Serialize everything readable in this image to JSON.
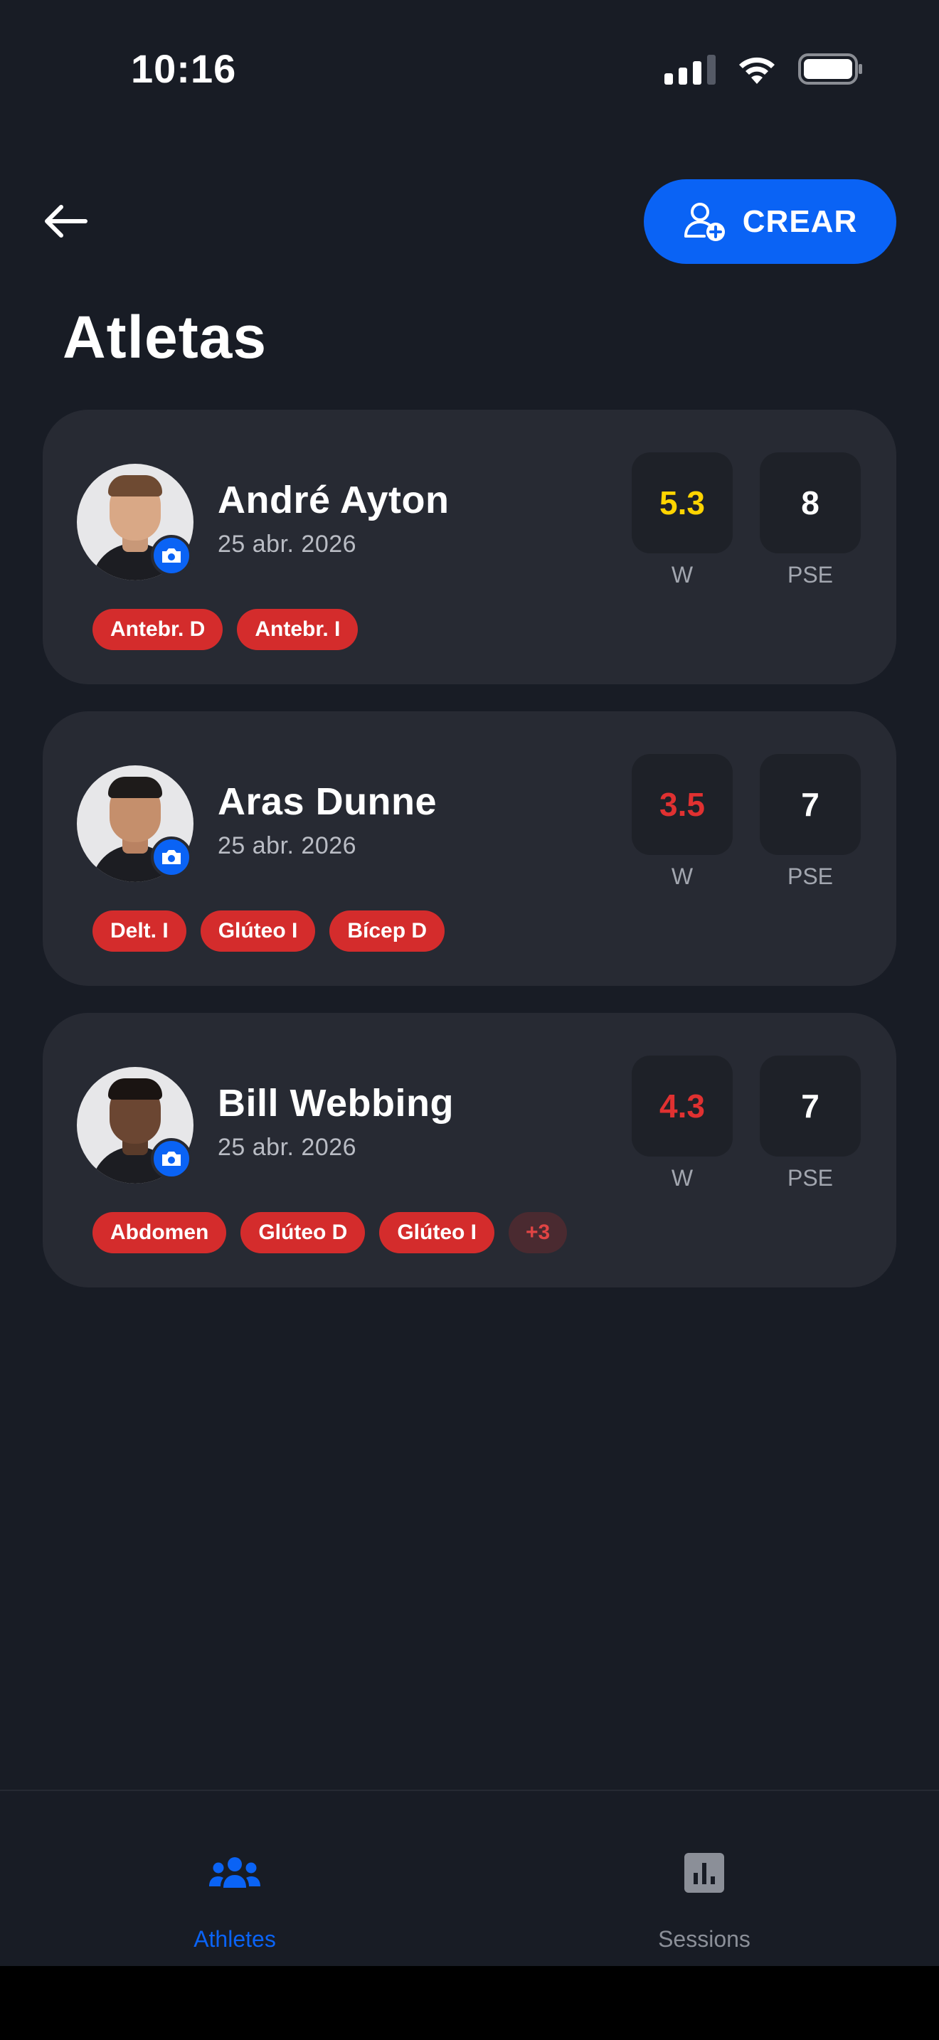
{
  "status_bar": {
    "time": "10:16"
  },
  "header": {
    "create_label": "CREAR",
    "page_title": "Atletas"
  },
  "athletes": [
    {
      "name": "André Ayton",
      "date": "25 abr. 2026",
      "w": "5.3",
      "pse": "8",
      "w_color": "#ffd400",
      "tags": [
        "Antebr. D",
        "Antebr. I"
      ],
      "more": ""
    },
    {
      "name": "Aras Dunne",
      "date": "25 abr. 2026",
      "w": "3.5",
      "pse": "7",
      "w_color": "#e03131",
      "tags": [
        "Delt. I",
        "Glúteo I",
        "Bícep D"
      ],
      "more": ""
    },
    {
      "name": "Bill Webbing",
      "date": "25 abr. 2026",
      "w": "4.3",
      "pse": "7",
      "w_color": "#e03131",
      "tags": [
        "Abdomen",
        "Glúteo D",
        "Glúteo I"
      ],
      "more": "+3"
    }
  ],
  "metric_labels": {
    "w": "W",
    "pse": "PSE"
  },
  "tabs": [
    {
      "label": "Athletes",
      "icon": "group-icon",
      "active": true
    },
    {
      "label": "Sessions",
      "icon": "bar-chart-icon",
      "active": false
    }
  ],
  "colors": {
    "accent": "#0a63f5",
    "background": "#181c25",
    "card": "#272a33",
    "tag": "#d42c2c"
  }
}
